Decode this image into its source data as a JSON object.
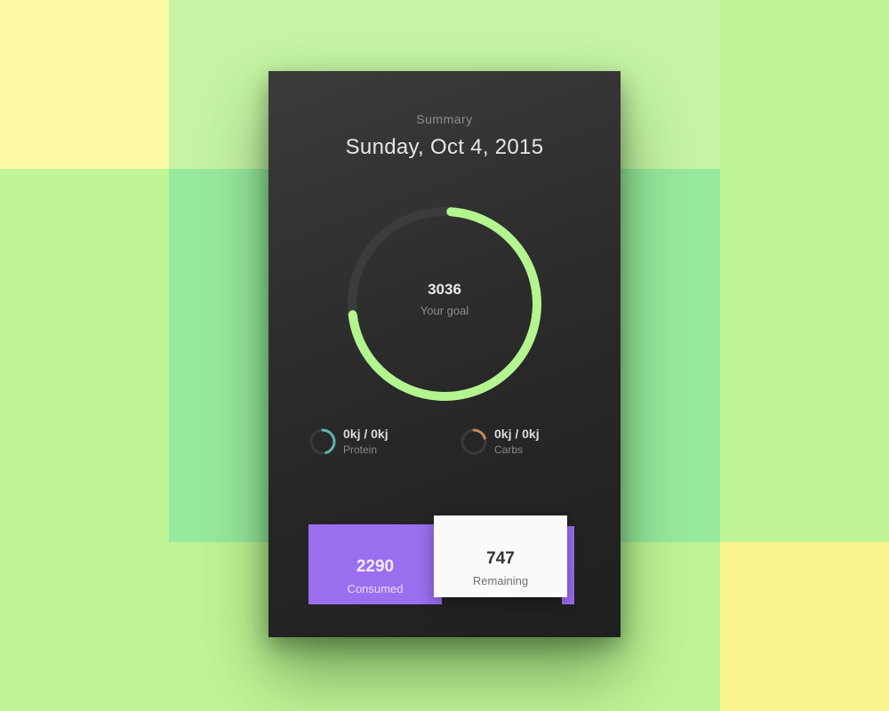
{
  "colors": {
    "background": "#bff595",
    "card": "#2c2c2c",
    "ring_progress": "#b3f58f",
    "ring_track": "#3c3c3c",
    "macro_a": "#5fb3b3",
    "macro_b": "#c98a5f",
    "consumed_button": "#9b6ef0",
    "remaining_button": "#fafafa"
  },
  "header": {
    "label": "Summary",
    "date": "Sunday, Oct 4, 2015"
  },
  "goal_ring": {
    "value": "3036",
    "caption": "Your goal",
    "progress": 0.72
  },
  "macros": [
    {
      "value": "0kj / 0kj",
      "label": "Protein",
      "icon": "partial-ring-icon",
      "progress": 0.45
    },
    {
      "value": "0kj / 0kj",
      "label": "Carbs",
      "icon": "partial-ring-icon",
      "progress": 0.2
    }
  ],
  "actions": {
    "consumed": {
      "value": "2290",
      "label": "Consumed"
    },
    "remaining": {
      "value": "747",
      "label": "Remaining"
    }
  }
}
